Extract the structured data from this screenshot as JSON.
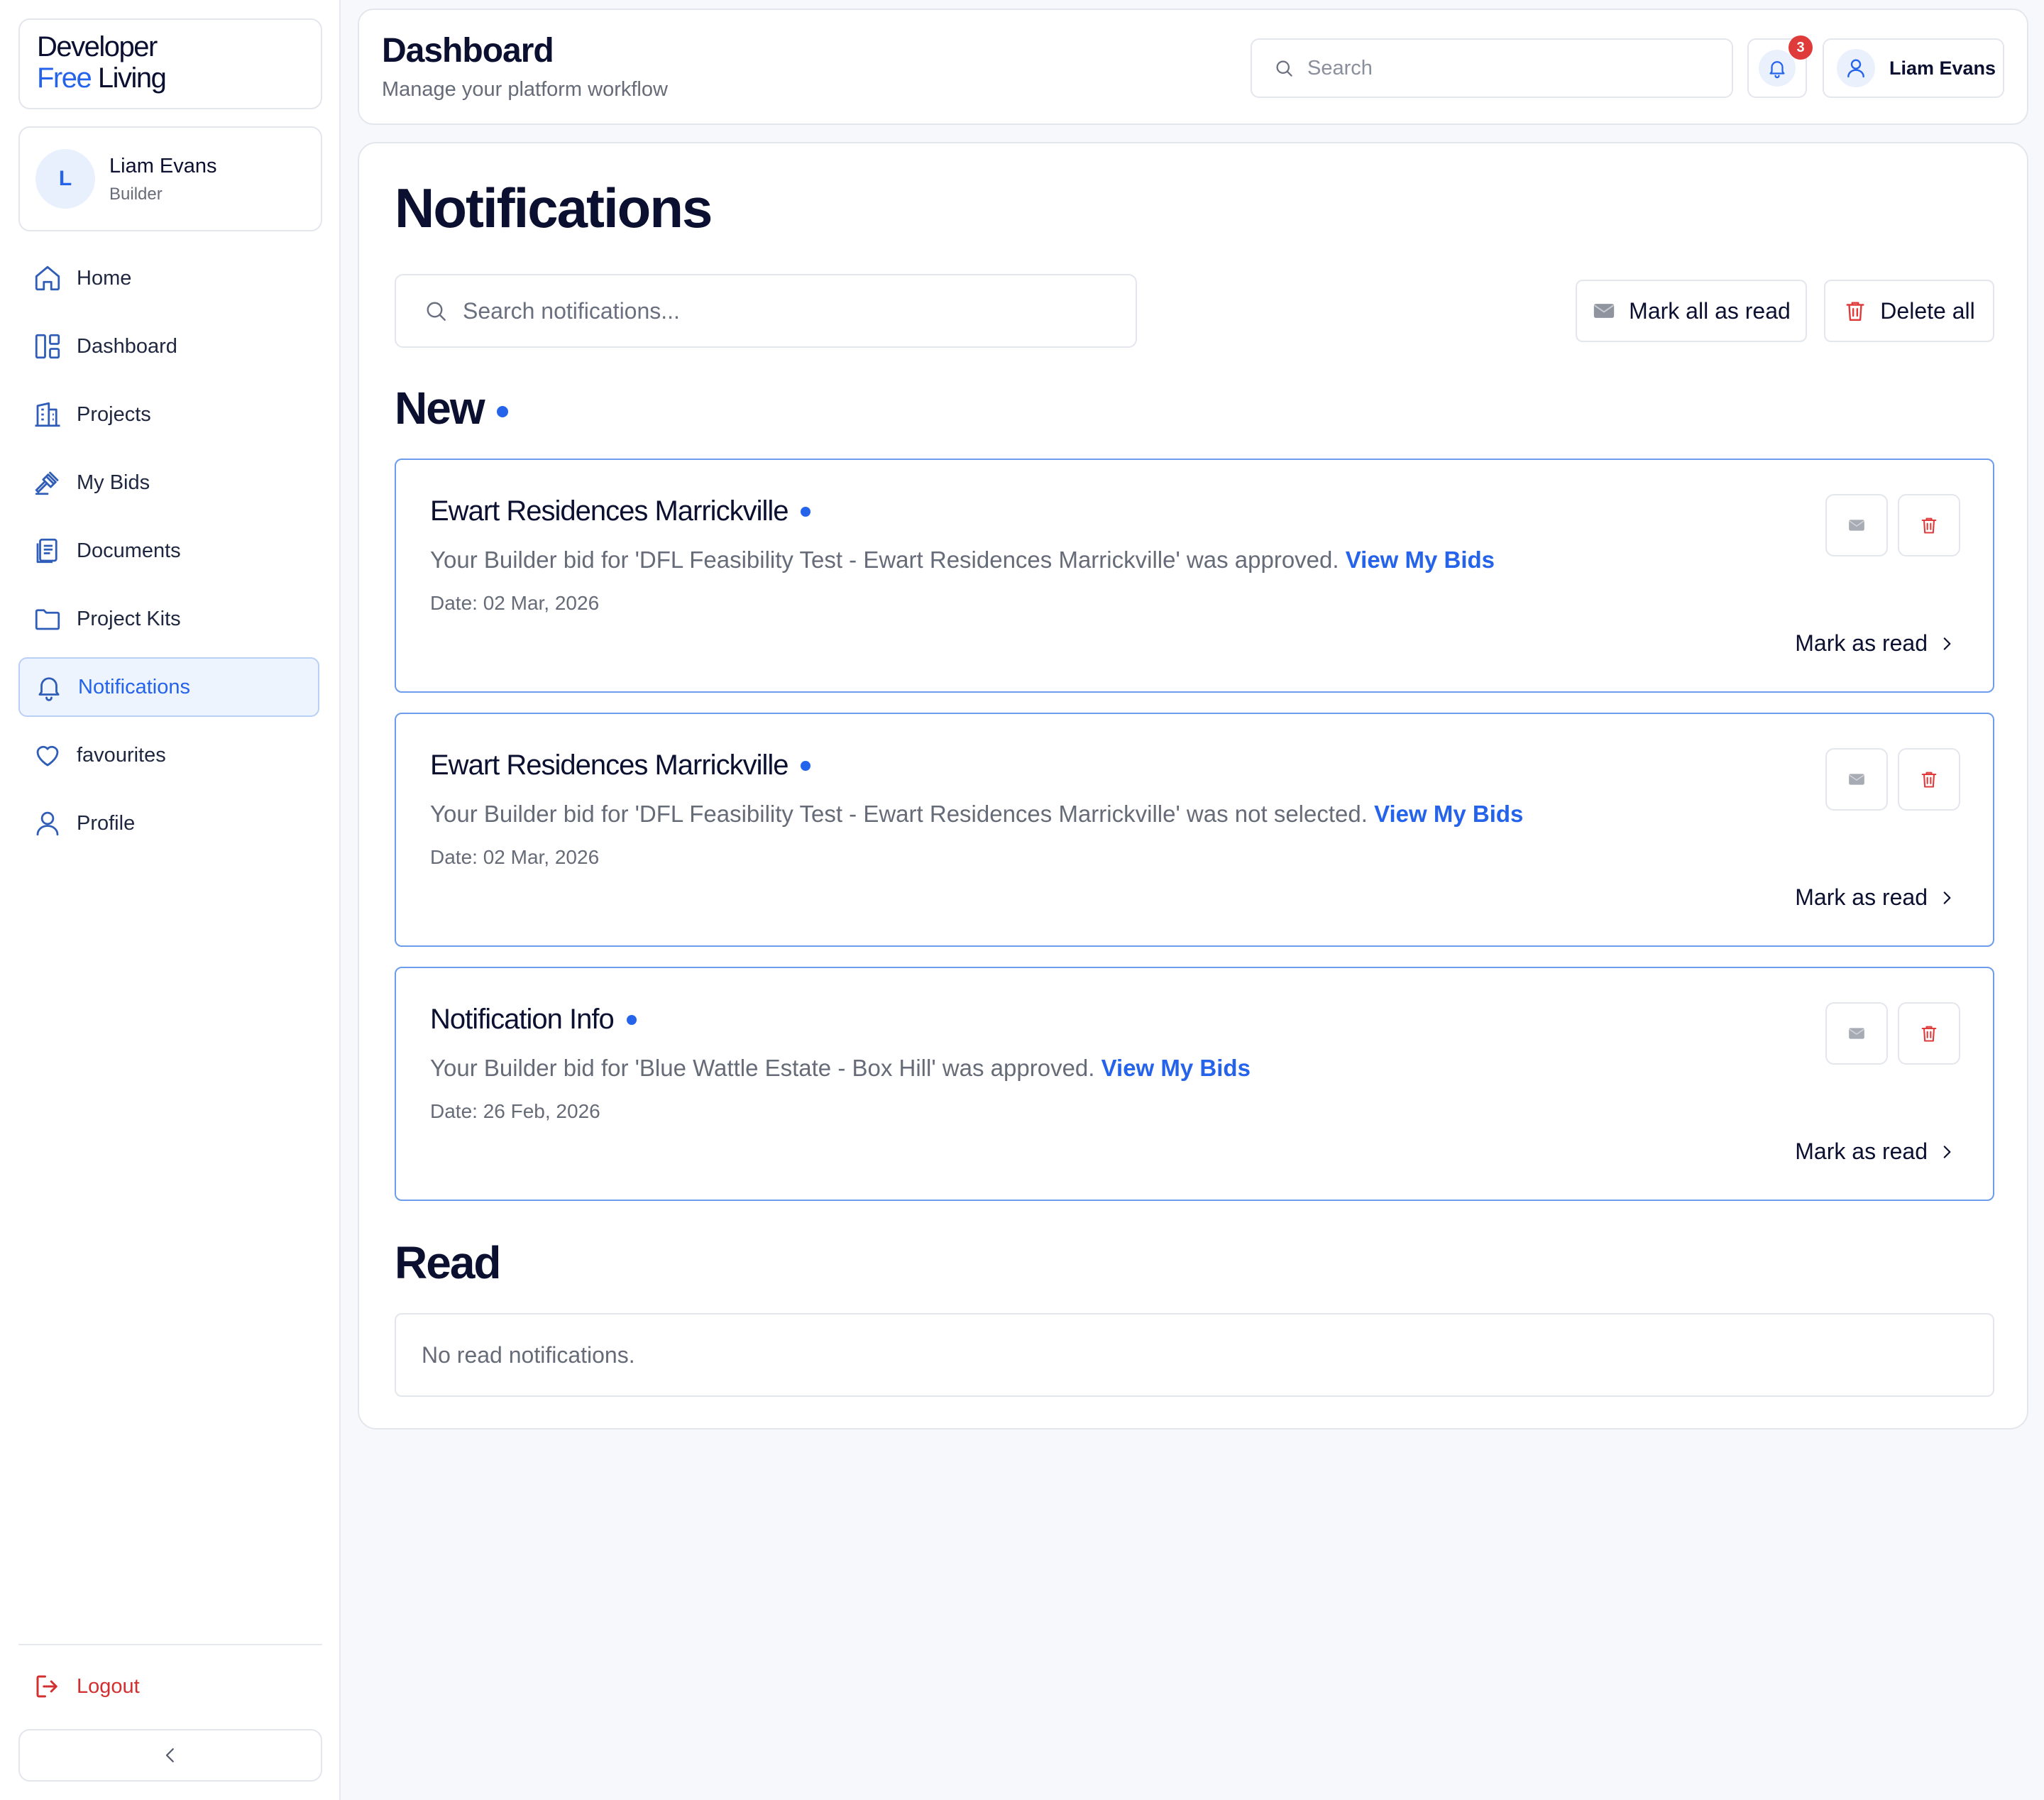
{
  "brand": {
    "line1": "Developer",
    "line2_accent": "Free",
    "line2_rest": " Living",
    "accent_color": "#2563eb"
  },
  "user": {
    "initial": "L",
    "name": "Liam Evans",
    "role": "Builder"
  },
  "nav": {
    "items": [
      {
        "label": "Home",
        "icon": "home-icon"
      },
      {
        "label": "Dashboard",
        "icon": "dashboard-grid-icon"
      },
      {
        "label": "Projects",
        "icon": "building-icon"
      },
      {
        "label": "My Bids",
        "icon": "gavel-icon"
      },
      {
        "label": "Documents",
        "icon": "document-icon"
      },
      {
        "label": "Project Kits",
        "icon": "folder-icon"
      },
      {
        "label": "Notifications",
        "icon": "bell-icon",
        "active": true
      },
      {
        "label": "favourites",
        "icon": "heart-icon"
      },
      {
        "label": "Profile",
        "icon": "user-icon"
      }
    ],
    "logout": "Logout",
    "logout_color": "#d32f2f"
  },
  "header": {
    "title": "Dashboard",
    "subtitle": "Manage your platform workflow",
    "search_placeholder": "Search",
    "notification_count": "3",
    "user_name": "Liam Evans"
  },
  "page": {
    "title": "Notifications",
    "search_placeholder": "Search notifications...",
    "mark_all_label": "Mark all as read",
    "delete_all_label": "Delete all",
    "new_heading": "New",
    "read_heading": "Read",
    "empty_read": "No read notifications."
  },
  "notifications": [
    {
      "title": "Ewart Residences Marrickville",
      "message": "Your Builder bid for 'DFL Feasibility Test - Ewart Residences Marrickville' was approved.",
      "link": "View My Bids",
      "date": "Date: 02 Mar, 2026",
      "mark_label": "Mark as read"
    },
    {
      "title": "Ewart Residences Marrickville",
      "message": "Your Builder bid for 'DFL Feasibility Test - Ewart Residences Marrickville' was not selected.",
      "link": "View My Bids",
      "date": "Date: 02 Mar, 2026",
      "mark_label": "Mark as read"
    },
    {
      "title": "Notification Info",
      "message": "Your Builder bid for 'Blue Wattle Estate - Box Hill' was approved.",
      "link": "View My Bids",
      "date": "Date: 26 Feb, 2026",
      "mark_label": "Mark as read"
    }
  ],
  "colors": {
    "primary": "#2563eb",
    "danger": "#df3b3b",
    "card_border_unread": "#6c9ceb"
  }
}
